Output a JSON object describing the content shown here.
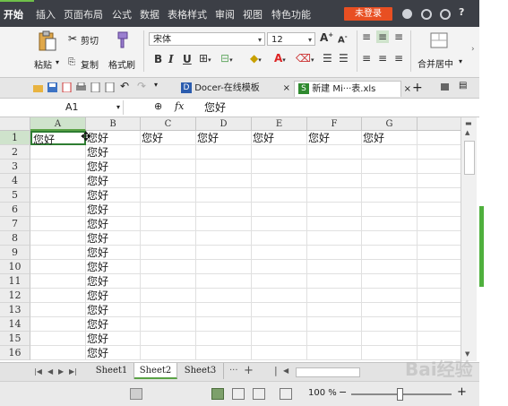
{
  "menu": {
    "items": [
      "开始",
      "插入",
      "页面布局",
      "公式",
      "数据",
      "表格样式",
      "审阅",
      "视图",
      "特色功能"
    ],
    "login_label": "未登录",
    "help_label": "?"
  },
  "ribbon": {
    "paste_label": "粘贴",
    "cut_label": "剪切",
    "copy_label": "复制",
    "format_painter_label": "格式刷",
    "font_name": "宋体",
    "font_size": "12",
    "bold": "B",
    "italic": "I",
    "underline": "U",
    "merge_center_label": "合并居中"
  },
  "tabbar": {
    "tabs": [
      {
        "label": "Docer-在线模板",
        "close": "×"
      },
      {
        "label": "新建 Mi···表.xls",
        "close": "×"
      }
    ],
    "new_tab": "+"
  },
  "formula": {
    "cell_ref": "A1",
    "fx": "fx",
    "content": "您好"
  },
  "grid": {
    "columns": [
      "A",
      "B",
      "C",
      "D",
      "E",
      "F",
      "G"
    ],
    "rows": [
      "1",
      "2",
      "3",
      "4",
      "5",
      "6",
      "7",
      "8",
      "9",
      "10",
      "11",
      "12",
      "13",
      "14",
      "15",
      "16"
    ],
    "row1": [
      "您好",
      "您好",
      "您好",
      "您好",
      "您好",
      "您好",
      "您好"
    ],
    "colB_text": "您好"
  },
  "sheets": {
    "tabs": [
      "Sheet1",
      "Sheet2",
      "Sheet3"
    ],
    "active": "Sheet2",
    "more": "···",
    "add": "+"
  },
  "status": {
    "zoom": "100 %",
    "minus": "−",
    "plus": "+"
  },
  "watermark": "Bai经验",
  "colors": {
    "menubar": "#3c3f46",
    "accent_green": "#5aa245",
    "login": "#e84f22"
  }
}
